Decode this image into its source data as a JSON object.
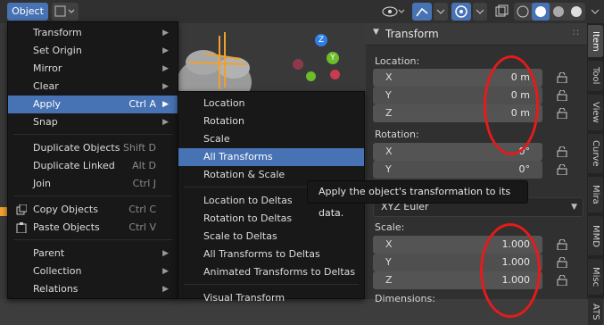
{
  "header": {
    "object_menu": "Object"
  },
  "object_menu": {
    "items": [
      {
        "label": "Transform",
        "arrow": true
      },
      {
        "label": "Set Origin",
        "arrow": true
      },
      {
        "label": "Mirror",
        "arrow": true
      },
      {
        "label": "Clear",
        "arrow": true
      },
      {
        "label": "Apply",
        "shortcut": "Ctrl A",
        "arrow": true,
        "highlighted": true
      },
      {
        "label": "Snap",
        "arrow": true
      },
      {
        "label": "Duplicate Objects",
        "shortcut": "Shift D"
      },
      {
        "label": "Duplicate Linked",
        "shortcut": "Alt D"
      },
      {
        "label": "Join",
        "shortcut": "Ctrl J"
      },
      {
        "label": "Copy Objects",
        "shortcut": "Ctrl C",
        "icon": "copy-icon"
      },
      {
        "label": "Paste Objects",
        "shortcut": "Ctrl V",
        "icon": "paste-icon"
      },
      {
        "label": "Parent",
        "arrow": true
      },
      {
        "label": "Collection",
        "arrow": true
      },
      {
        "label": "Relations",
        "arrow": true
      }
    ]
  },
  "apply_menu": {
    "items": [
      {
        "label": "Location"
      },
      {
        "label": "Rotation"
      },
      {
        "label": "Scale"
      },
      {
        "label": "All Transforms",
        "highlighted": true
      },
      {
        "label": "Rotation & Scale"
      },
      {
        "label": "Location to Deltas"
      },
      {
        "label": "Rotation to Deltas"
      },
      {
        "label": "Scale to Deltas"
      },
      {
        "label": "All Transforms to Deltas"
      },
      {
        "label": "Animated Transforms to Deltas"
      },
      {
        "label": "Visual Transform"
      }
    ]
  },
  "tooltip": "Apply the object's transformation to its data.",
  "panel": {
    "title": "Transform",
    "location_label": "Location:",
    "location": [
      {
        "axis": "X",
        "value": "0 m"
      },
      {
        "axis": "Y",
        "value": "0 m"
      },
      {
        "axis": "Z",
        "value": "0 m"
      }
    ],
    "rotation_label": "Rotation:",
    "rotation": [
      {
        "axis": "X",
        "value": "0°"
      },
      {
        "axis": "Y",
        "value": "0°"
      }
    ],
    "rotation_mode": "XYZ Euler",
    "scale_label": "Scale:",
    "scale": [
      {
        "axis": "X",
        "value": "1.000"
      },
      {
        "axis": "Y",
        "value": "1.000"
      },
      {
        "axis": "Z",
        "value": "1.000"
      }
    ],
    "dimensions_label": "Dimensions:"
  },
  "tabs": [
    "Item",
    "Tool",
    "View",
    "Curve",
    "Mira",
    "MMD",
    "Misc",
    "ATS"
  ],
  "gizmo": {
    "z": "Z",
    "y": "Y"
  },
  "colors": {
    "highlight": "#4772b3",
    "annotation": "#e41b1b"
  }
}
